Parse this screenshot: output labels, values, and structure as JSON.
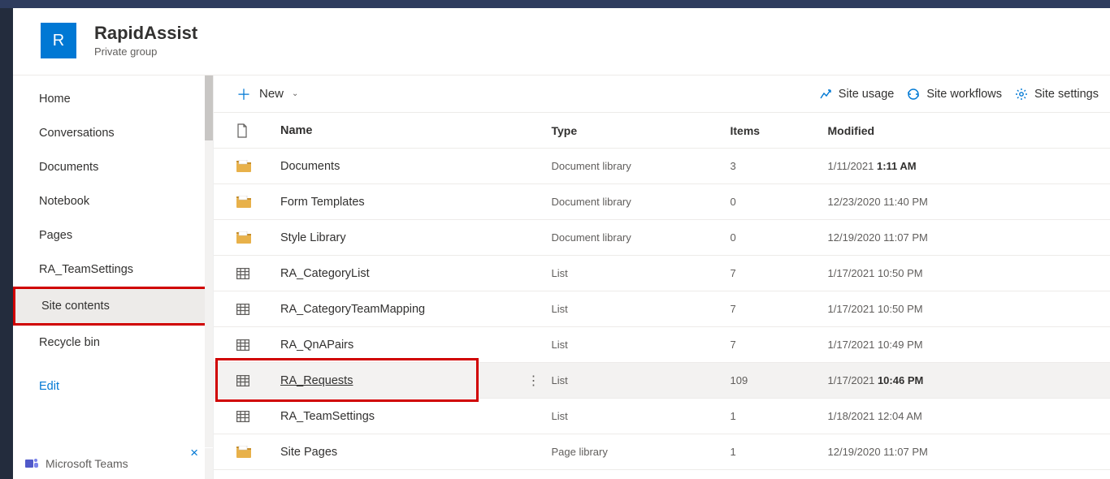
{
  "site": {
    "logo_letter": "R",
    "title": "RapidAssist",
    "subtitle": "Private group"
  },
  "sidebar": {
    "items": [
      {
        "label": "Home"
      },
      {
        "label": "Conversations"
      },
      {
        "label": "Documents"
      },
      {
        "label": "Notebook"
      },
      {
        "label": "Pages"
      },
      {
        "label": "RA_TeamSettings"
      },
      {
        "label": "Site contents",
        "selected": true
      },
      {
        "label": "Recycle bin"
      }
    ],
    "edit_label": "Edit",
    "teams_label": "Microsoft Teams"
  },
  "cmdbar": {
    "new_label": "New",
    "site_usage": "Site usage",
    "site_workflows": "Site workflows",
    "site_settings": "Site settings"
  },
  "table": {
    "headers": {
      "name": "Name",
      "type": "Type",
      "items": "Items",
      "modified": "Modified"
    },
    "rows": [
      {
        "icon": "doclib",
        "name": "Documents",
        "type": "Document library",
        "items": "3",
        "mod_date": "1/11/2021 ",
        "mod_time": "1:11 AM"
      },
      {
        "icon": "doclib",
        "name": "Form Templates",
        "type": "Document library",
        "items": "0",
        "mod_date": "12/23/2020 11:40 PM",
        "mod_time": ""
      },
      {
        "icon": "doclib",
        "name": "Style Library",
        "type": "Document library",
        "items": "0",
        "mod_date": "12/19/2020 11:07 PM",
        "mod_time": ""
      },
      {
        "icon": "list",
        "name": "RA_CategoryList",
        "type": "List",
        "items": "7",
        "mod_date": "1/17/2021 10:50 PM",
        "mod_time": ""
      },
      {
        "icon": "list",
        "name": "RA_CategoryTeamMapping",
        "type": "List",
        "items": "7",
        "mod_date": "1/17/2021 10:50 PM",
        "mod_time": ""
      },
      {
        "icon": "list",
        "name": "RA_QnAPairs",
        "type": "List",
        "items": "7",
        "mod_date": "1/17/2021 10:49 PM",
        "mod_time": ""
      },
      {
        "icon": "list",
        "name": "RA_Requests",
        "type": "List",
        "items": "109",
        "mod_date": "1/17/2021 ",
        "mod_time": "10:46 PM",
        "hovered": true,
        "boxed": true
      },
      {
        "icon": "list",
        "name": "RA_TeamSettings",
        "type": "List",
        "items": "1",
        "mod_date": "1/18/2021 12:04 AM",
        "mod_time": ""
      },
      {
        "icon": "doclib",
        "name": "Site Pages",
        "type": "Page library",
        "items": "1",
        "mod_date": "12/19/2020 11:07 PM",
        "mod_time": ""
      }
    ]
  }
}
